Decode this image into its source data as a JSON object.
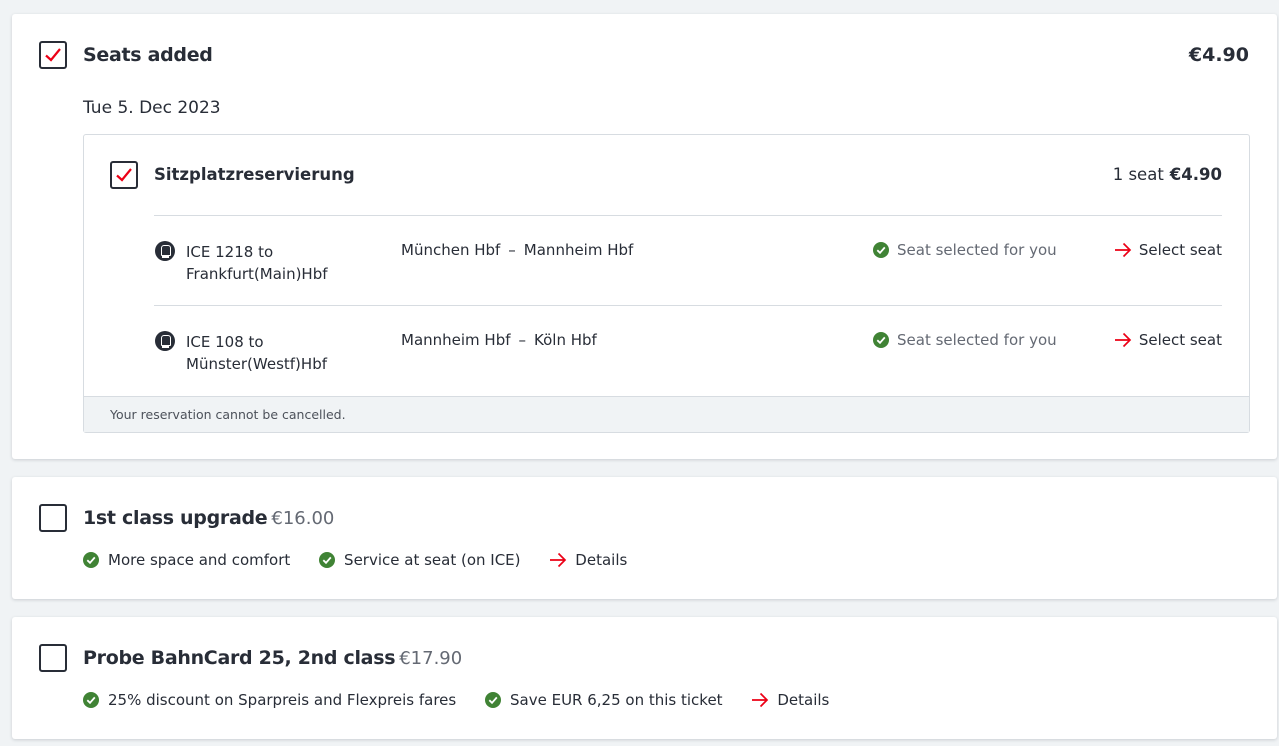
{
  "colors": {
    "accent_red": "#ec0016",
    "check_green": "#408335",
    "text": "#282d37",
    "muted": "#646973"
  },
  "seats_card": {
    "title": "Seats added",
    "checked": true,
    "total_price": "€4.90",
    "date": "Tue 5. Dec 2023",
    "reservation": {
      "title": "Sitzplatzreservierung",
      "checked": true,
      "count": "1 seat",
      "price": "€4.90",
      "legs": [
        {
          "train": "ICE 1218 to Frankfurt(Main)Hbf",
          "from": "München Hbf",
          "separator": "–",
          "to": "Mannheim Hbf",
          "status": "Seat selected for you",
          "action": "Select seat",
          "icon": "train-icon"
        },
        {
          "train": "ICE 108 to Münster(Westf)Hbf",
          "from": "Mannheim Hbf",
          "separator": "–",
          "to": "Köln Hbf",
          "status": "Seat selected for you",
          "action": "Select seat",
          "icon": "train-icon"
        }
      ],
      "note": "Your reservation cannot be cancelled."
    }
  },
  "upgrade_card": {
    "title": "1st class upgrade",
    "price": "€16.00",
    "checked": false,
    "features": [
      "More space and comfort",
      "Service at seat (on ICE)"
    ],
    "details_label": "Details"
  },
  "bahncard_card": {
    "title": "Probe BahnCard 25, 2nd class",
    "price": "€17.90",
    "checked": false,
    "features": [
      "25% discount on Sparpreis and Flexpreis fares",
      "Save EUR 6,25 on this ticket"
    ],
    "details_label": "Details"
  }
}
